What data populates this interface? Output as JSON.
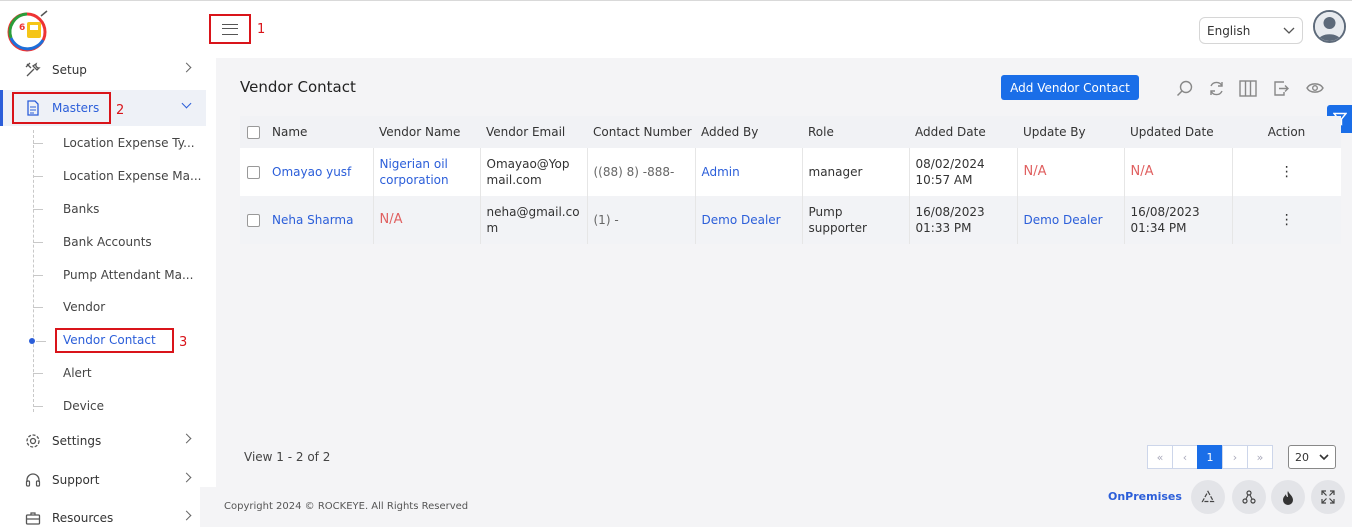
{
  "header": {
    "language": "English",
    "markers": [
      "1",
      "2",
      "3"
    ]
  },
  "sidebar": {
    "items": [
      {
        "label": "Setup",
        "icon": "tools-icon"
      },
      {
        "label": "Masters",
        "icon": "document-icon"
      },
      {
        "label": "Settings",
        "icon": "gear-icon"
      },
      {
        "label": "Support",
        "icon": "headset-icon"
      },
      {
        "label": "Resources",
        "icon": "briefcase-icon"
      }
    ],
    "sub_items": [
      "Location Expense Ty...",
      "Location Expense Ma...",
      "Banks",
      "Bank Accounts",
      "Pump Attendant Ma...",
      "Vendor",
      "Vendor Contact",
      "Alert",
      "Device"
    ],
    "active_sub_item": "Vendor Contact"
  },
  "main": {
    "title": "Vendor Contact",
    "add_button": "Add Vendor Contact",
    "columns": [
      "Name",
      "Vendor Name",
      "Vendor Email",
      "Contact Number",
      "Added By",
      "Role",
      "Added Date",
      "Update By",
      "Updated Date",
      "Action"
    ],
    "rows": [
      {
        "name": "Omayao yusf",
        "vendor_name": "Nigerian oil corporation",
        "vendor_email": "Omayao@Yopmail.com",
        "contact_number": "((88) 8) -888-",
        "added_by": "Admin",
        "role": "manager",
        "added_date": "08/02/2024 10:57 AM",
        "update_by": "N/A",
        "updated_date": "N/A",
        "action": "⋮"
      },
      {
        "name": "Neha Sharma",
        "vendor_name": "N/A",
        "vendor_email": "neha@gmail.com",
        "contact_number": "(1) -",
        "added_by": "Demo Dealer",
        "role": "Pump supporter",
        "added_date": "16/08/2023 01:33 PM",
        "update_by": "Demo Dealer",
        "updated_date": "16/08/2023 01:34 PM",
        "action": "⋮"
      }
    ],
    "view_text": "View 1 - 2 of 2",
    "pagination": {
      "first": "«",
      "prev": "‹",
      "current": "1",
      "next": "›",
      "last": "»"
    },
    "per_page": "20"
  },
  "footer": {
    "copyright": "Copyright 2024 © ROCKEYE. All Rights Reserved",
    "mode": "OnPremises"
  },
  "colors": {
    "primary": "#1a6ee8",
    "highlight_box": "#d9141a",
    "link": "#2b5ed9",
    "na": "#e06060"
  }
}
